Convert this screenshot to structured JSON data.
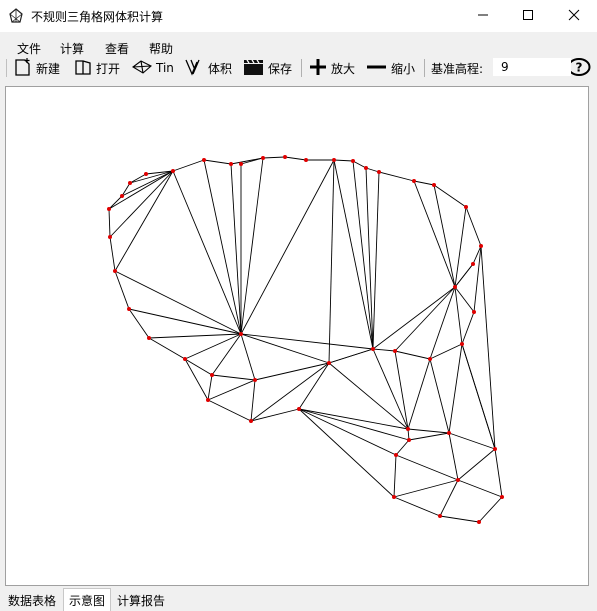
{
  "window": {
    "title": "不规则三角格网体积计算"
  },
  "menu": [
    "文件",
    "计算",
    "查看",
    "帮助"
  ],
  "toolbar": {
    "new": "新建",
    "open": "打开",
    "tin": "Tin",
    "volume": "体积",
    "save": "保存",
    "zoom_in": "放大",
    "zoom_out": "缩小",
    "base_elevation_label": "基准高程:",
    "base_elevation_value": "9"
  },
  "tabs": [
    "数据表格",
    "示意图",
    "计算报告"
  ],
  "active_tab": "示意图",
  "colors": {
    "point": "#e00000",
    "edge": "#000000",
    "canvas": "#ffffff"
  }
}
